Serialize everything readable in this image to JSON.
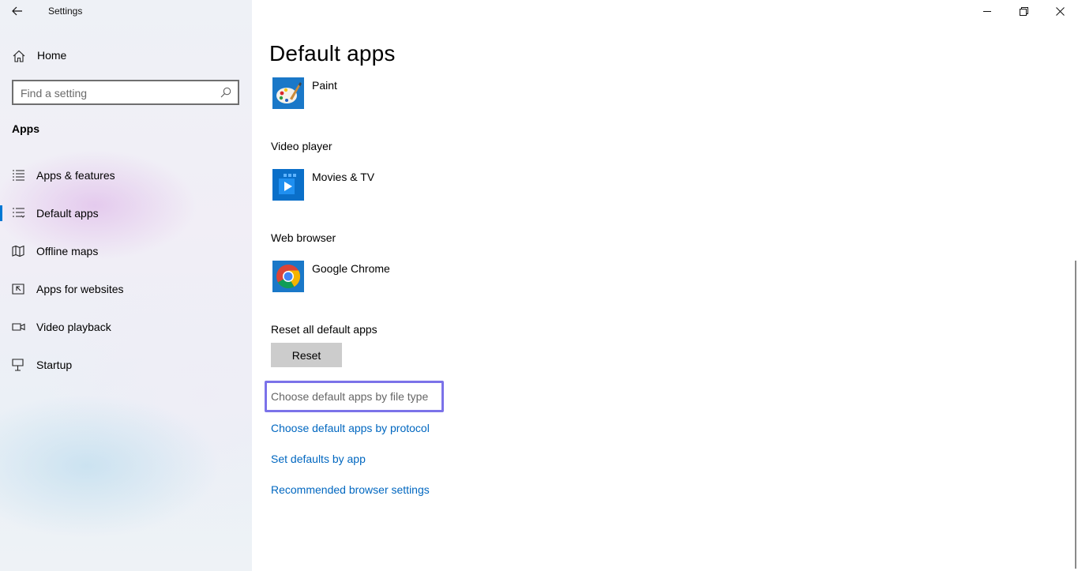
{
  "window": {
    "title": "Settings"
  },
  "sidebar": {
    "home_label": "Home",
    "search_placeholder": "Find a setting",
    "section_heading": "Apps",
    "items": [
      {
        "label": "Apps & features",
        "icon": "apps-features-icon"
      },
      {
        "label": "Default apps",
        "icon": "default-apps-icon",
        "selected": true
      },
      {
        "label": "Offline maps",
        "icon": "offline-maps-icon"
      },
      {
        "label": "Apps for websites",
        "icon": "apps-for-websites-icon"
      },
      {
        "label": "Video playback",
        "icon": "video-playback-icon"
      },
      {
        "label": "Startup",
        "icon": "startup-icon"
      }
    ]
  },
  "main": {
    "page_title": "Default apps",
    "photo_viewer_app": "Paint",
    "video_player": {
      "label": "Video player",
      "app": "Movies & TV"
    },
    "web_browser": {
      "label": "Web browser",
      "app": "Google Chrome"
    },
    "reset": {
      "label": "Reset all default apps",
      "button": "Reset"
    },
    "links": {
      "by_file_type": "Choose default apps by file type",
      "by_protocol": "Choose default apps by protocol",
      "by_app": "Set defaults by app",
      "browser_settings": "Recommended browser settings"
    }
  },
  "colors": {
    "accent": "#0078d4",
    "link": "#0067c0",
    "focus_outline": "#7b72e9",
    "reset_button": "#cccccc"
  }
}
